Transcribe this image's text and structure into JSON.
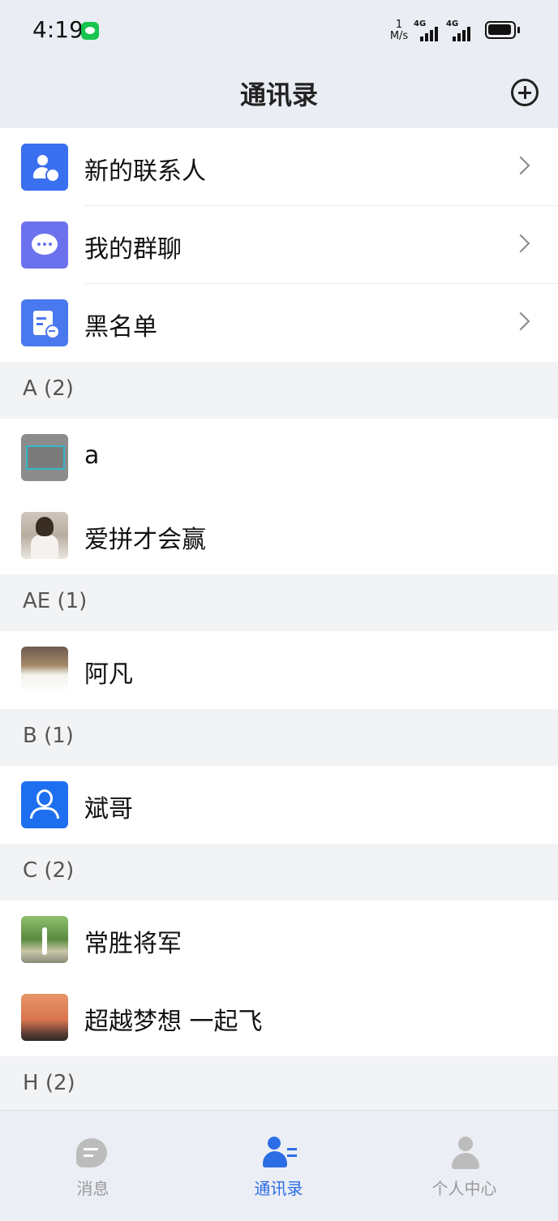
{
  "status_bar": {
    "time": "4:19",
    "speed_value": "1",
    "speed_unit": "M/s",
    "network_1": "4G",
    "network_2": "4G"
  },
  "header": {
    "title": "通讯录"
  },
  "menu": [
    {
      "label": "新的联系人",
      "icon": "add-contact-icon"
    },
    {
      "label": "我的群聊",
      "icon": "group-chat-icon"
    },
    {
      "label": "黑名单",
      "icon": "blacklist-icon"
    }
  ],
  "sections": [
    {
      "header": "A (2)",
      "contacts": [
        {
          "name": "a"
        },
        {
          "name": "爱拼才会赢"
        }
      ]
    },
    {
      "header": "AE (1)",
      "contacts": [
        {
          "name": "阿凡"
        }
      ]
    },
    {
      "header": "B (1)",
      "contacts": [
        {
          "name": "斌哥"
        }
      ]
    },
    {
      "header": "C (2)",
      "contacts": [
        {
          "name": "常胜将军"
        },
        {
          "name": "超越梦想 一起飞"
        }
      ]
    }
  ],
  "partial_section": {
    "header": "H (2)"
  },
  "tabs": [
    {
      "label": "消息",
      "icon": "message-icon",
      "active": false
    },
    {
      "label": "通讯录",
      "icon": "contacts-icon",
      "active": true
    },
    {
      "label": "个人中心",
      "icon": "profile-icon",
      "active": false
    }
  ],
  "colors": {
    "accent": "#2b6de5",
    "header_bg": "#ebedf4",
    "section_bg": "#f2f3f5",
    "inactive_tab": "#999999"
  }
}
